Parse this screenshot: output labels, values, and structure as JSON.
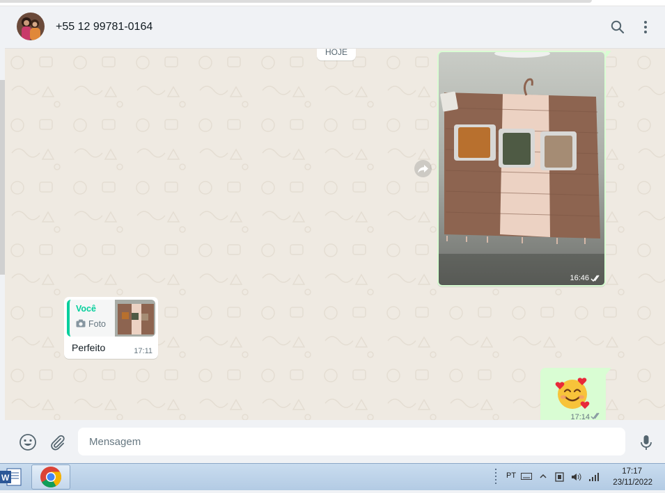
{
  "header": {
    "contact_name": "+55 12 99781-0164",
    "avatar_icon": "contact-avatar",
    "search_icon": "search-icon",
    "menu_icon": "kebab-menu-icon"
  },
  "chat": {
    "date_separator": "HOJE",
    "messages": [
      {
        "direction": "outgoing",
        "type": "image",
        "image_desc": "woven-placemat-with-thread-cards",
        "time": "16:46",
        "status": "read-double-check"
      },
      {
        "direction": "incoming",
        "type": "text",
        "quoted": {
          "author": "Você",
          "type_label": "Foto",
          "type_icon": "camera-icon"
        },
        "text": "Perfeito",
        "time": "17:11"
      },
      {
        "direction": "outgoing",
        "type": "emoji",
        "emoji": "🥰",
        "time": "17:14",
        "status": "read-double-check"
      }
    ]
  },
  "composer": {
    "placeholder": "Mensagem",
    "emoji_icon": "emoji-icon",
    "attach_icon": "paperclip-icon",
    "mic_icon": "microphone-icon"
  },
  "taskbar": {
    "apps": [
      "word-icon",
      "chrome-icon"
    ],
    "language": "PT",
    "clock_time": "17:17",
    "clock_date": "23/11/2022"
  },
  "colors": {
    "outgoing_bubble": "#d9fdd3",
    "incoming_bubble": "#ffffff",
    "chat_background": "#efeae2",
    "accent_green": "#06cf9c",
    "header_background": "#f0f2f5"
  }
}
